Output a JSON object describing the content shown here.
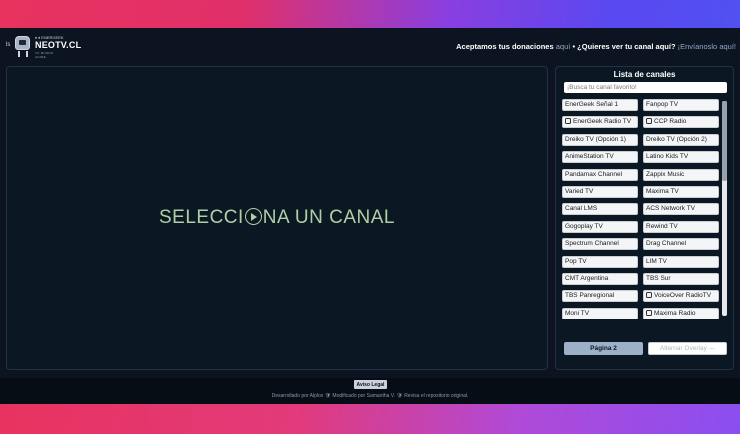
{
  "header": {
    "logo_brand": "NEOTV.CL",
    "logo_prefix": "ls",
    "logo_sub": "♦ ♦ ENERGEEK",
    "logo_slogan": "TU MUNDO ANIME",
    "donations_text": "Aceptamos tus donaciones",
    "donations_link": "aquí",
    "separator": " • ",
    "channel_question": "¿Quieres ver tu canal aquí?",
    "send_link": "¡Envíanoslo aquí!"
  },
  "player": {
    "placeholder_before": "SELECCI",
    "placeholder_after": "NA UN CANAL"
  },
  "sidebar": {
    "title": "Lista de canales",
    "search_placeholder": "¡Busca tu canal favorito!",
    "channels": [
      {
        "label": "EnerGeek Señal 1",
        "icon": false
      },
      {
        "label": "Fanpop TV",
        "icon": false
      },
      {
        "label": "EnerGeek Radio TV",
        "icon": true
      },
      {
        "label": "CCP Radio",
        "icon": true
      },
      {
        "label": "Dreiko TV (Opción 1)",
        "icon": false
      },
      {
        "label": "Dreiko TV (Opción 2)",
        "icon": false
      },
      {
        "label": "AnimeStation TV",
        "icon": false
      },
      {
        "label": "Latino Kids TV",
        "icon": false
      },
      {
        "label": "Pandamax Channel",
        "icon": false
      },
      {
        "label": "Zappix Music",
        "icon": false
      },
      {
        "label": "Varied TV",
        "icon": false
      },
      {
        "label": "Maxima TV",
        "icon": false
      },
      {
        "label": "Canal LMS",
        "icon": false
      },
      {
        "label": "ACS Network TV",
        "icon": false
      },
      {
        "label": "Gogoplay TV",
        "icon": false
      },
      {
        "label": "Rewind TV",
        "icon": false
      },
      {
        "label": "Spectrum Channel",
        "icon": false
      },
      {
        "label": "Drag Channel",
        "icon": false
      },
      {
        "label": "Pop TV",
        "icon": false
      },
      {
        "label": "LIM TV",
        "icon": false
      },
      {
        "label": "CMT Argentina",
        "icon": false
      },
      {
        "label": "TBS Sur",
        "icon": false
      },
      {
        "label": "TBS Panregional",
        "icon": false
      },
      {
        "label": "VoiceOver RadioTV",
        "icon": true
      },
      {
        "label": "Moni TV",
        "icon": false
      },
      {
        "label": "Maxima Radio",
        "icon": true
      }
    ],
    "page_button": "Página 2",
    "overlay_button": "Alternar Overlay ---"
  },
  "footer": {
    "legal_button": "Aviso Legal",
    "credits": "Desarrollado por Alplox 🛡 Modificado por Samantha V. 🛡 Revisa el repositorio original."
  }
}
